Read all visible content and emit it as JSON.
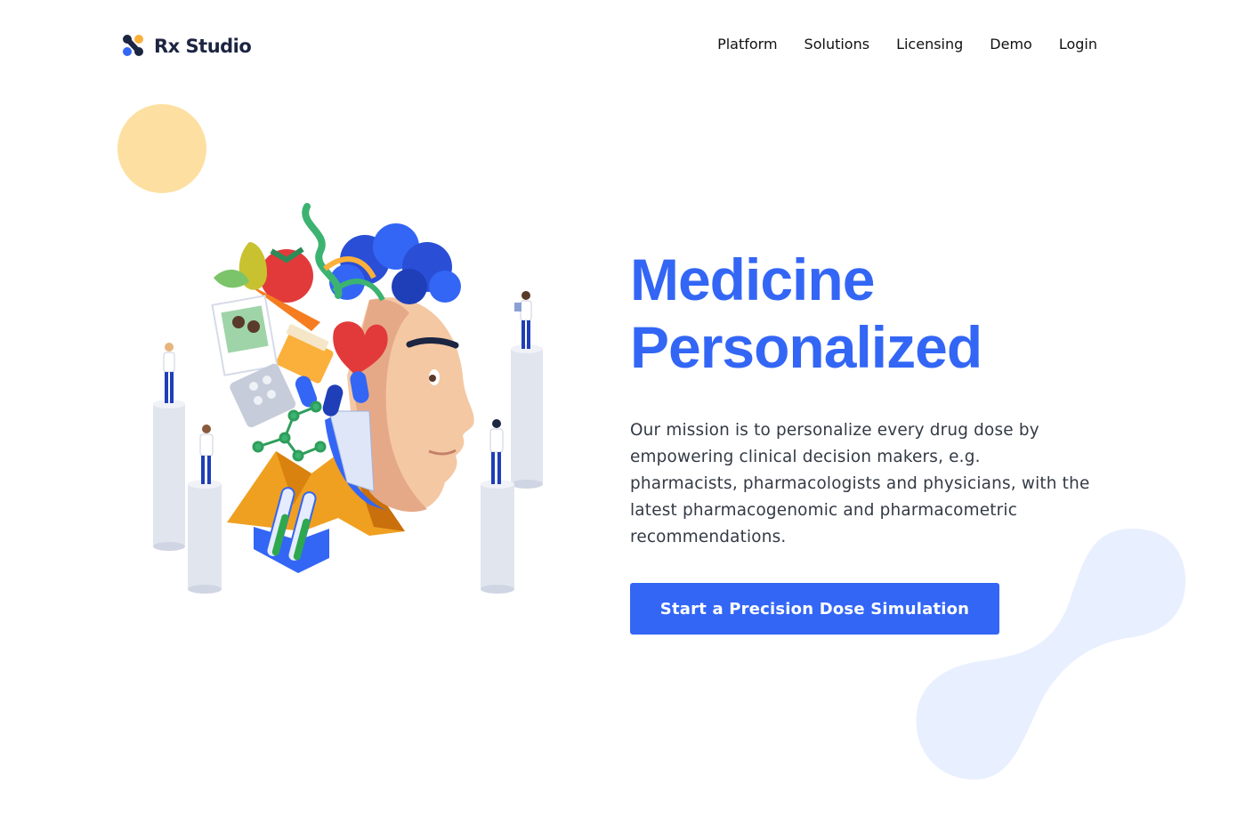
{
  "brand": {
    "name": "Rx Studio",
    "colors": {
      "primary": "#3366f5",
      "dark": "#1c2541",
      "accent_yellow": "#fbb03b",
      "blob": "#e8efff",
      "circle": "#fde0a1"
    }
  },
  "nav": {
    "items": [
      {
        "label": "Platform"
      },
      {
        "label": "Solutions"
      },
      {
        "label": "Licensing"
      },
      {
        "label": "Demo"
      },
      {
        "label": "Login"
      }
    ]
  },
  "hero": {
    "title_line1": "Medicine",
    "title_line2": "Personalized",
    "description": "Our mission is to personalize every drug dose by empowering clinical decision makers, e.g. pharmacists, pharmacologists and physicians, with the latest pharmacogenomic and pharmacometric recommendations.",
    "cta_label": "Start a Precision Dose Simulation"
  },
  "illustration": {
    "icon": "personalized-medicine-head-illustration"
  }
}
